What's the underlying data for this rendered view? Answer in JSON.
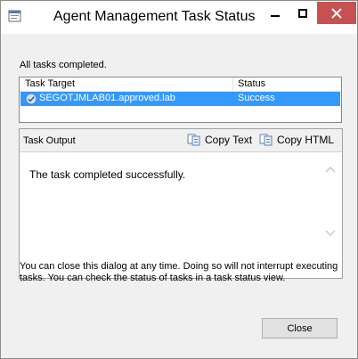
{
  "window": {
    "title": "Agent Management Task Status",
    "icon": "task-status-app-icon",
    "controls": {
      "minimize": "minimize-icon",
      "maximize": "maximize-icon",
      "close": "close-icon"
    },
    "accent_close_color": "#c75050"
  },
  "status_message": "All tasks completed.",
  "task_list": {
    "columns": [
      "Task Target",
      "Status"
    ],
    "rows": [
      {
        "target": "SEGOTJMLAB01.approved.lab",
        "status": "Success",
        "icon": "success-check-icon",
        "selected": true
      }
    ],
    "selection_color": "#3399ff"
  },
  "task_output": {
    "label": "Task Output",
    "copy_text_label": "Copy Text",
    "copy_html_label": "Copy HTML",
    "text": "The task completed successfully."
  },
  "info_text": "You can close this dialog at any time. Doing so will not interrupt executing tasks. You can check the status of tasks in a task status view.",
  "buttons": {
    "close_label": "Close"
  }
}
